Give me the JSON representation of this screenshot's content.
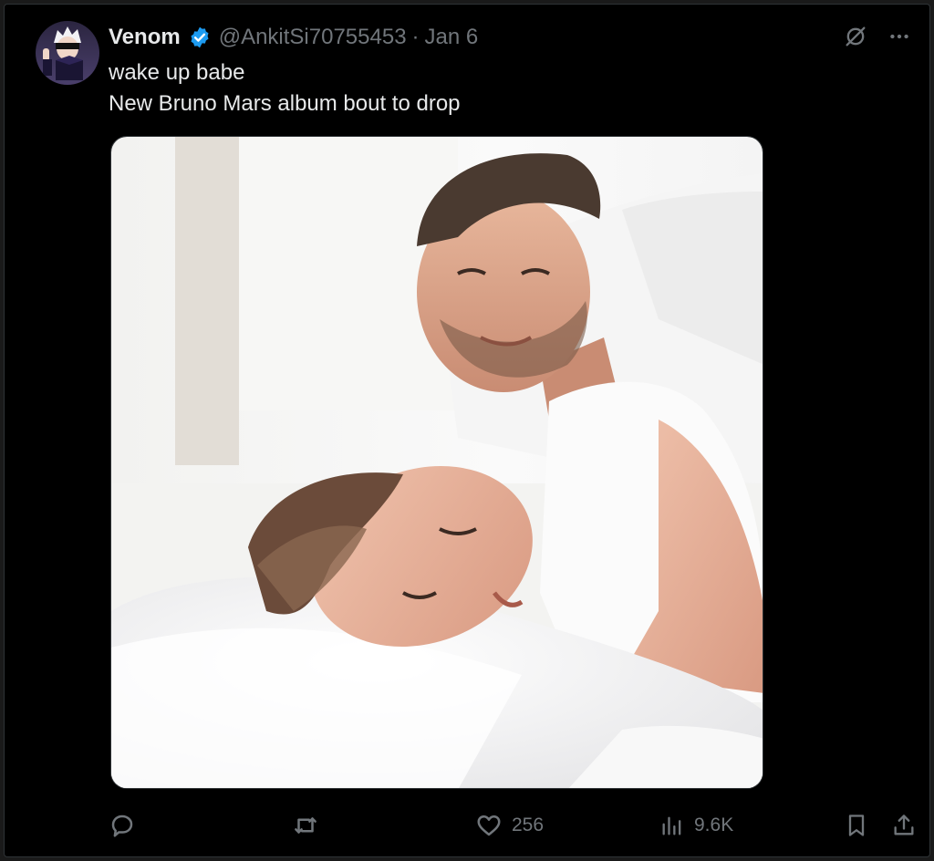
{
  "tweet": {
    "display_name": "Venom",
    "handle": "@AnkitSi70755453",
    "separator": "·",
    "date": "Jan 6",
    "text_lines": [
      "wake up babe",
      "New Bruno Mars album bout to drop"
    ]
  },
  "actions": {
    "likes": "256",
    "views": "9.6K"
  },
  "icons": {
    "avatar": "avatar-anime-character",
    "verified": "verified-badge-icon",
    "grok": "grok-icon",
    "more": "more-icon",
    "reply": "reply-icon",
    "retweet": "retweet-icon",
    "like": "heart-icon",
    "views": "views-chart-icon",
    "bookmark": "bookmark-icon",
    "share": "share-icon"
  },
  "colors": {
    "background": "#000000",
    "text_primary": "#e7e9ea",
    "text_secondary": "#71767b",
    "verified_blue": "#1d9bf0"
  }
}
